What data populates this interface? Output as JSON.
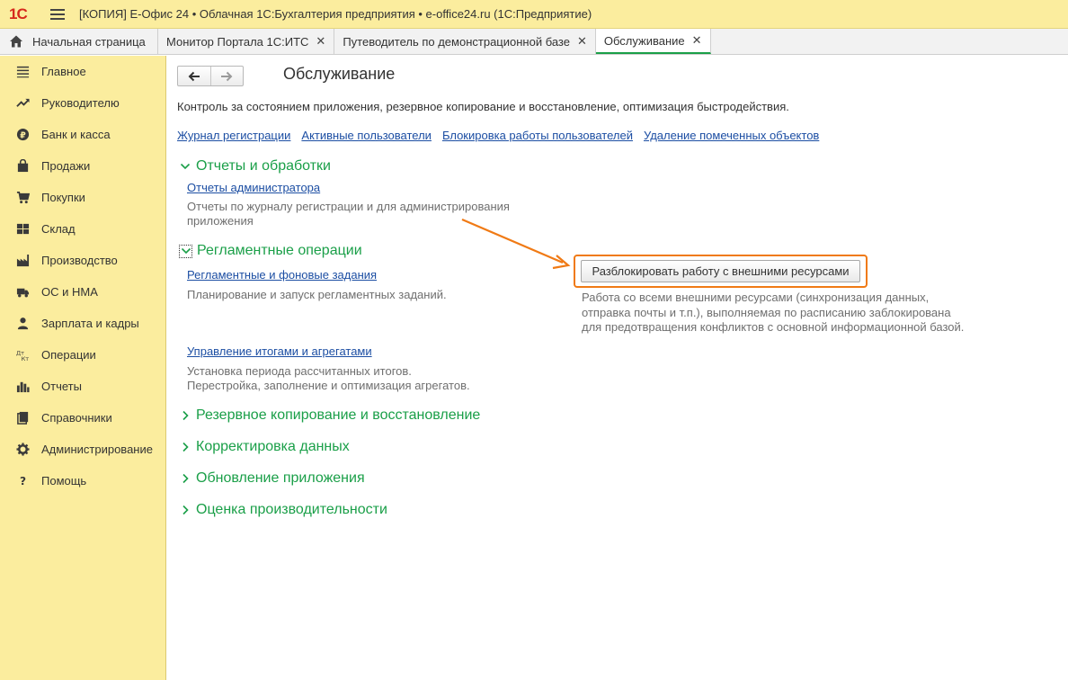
{
  "window": {
    "logo_text": "1С",
    "title": "[КОПИЯ] Е-Офис 24 • Облачная 1С:Бухгалтерия предприятия • e-office24.ru  (1С:Предприятие)"
  },
  "tabs": [
    {
      "label": "Начальная страница"
    },
    {
      "label": "Монитор Портала 1С:ИТС",
      "close": "✕"
    },
    {
      "label": "Путеводитель по демонстрационной базе",
      "close": "✕"
    },
    {
      "label": "Обслуживание",
      "close": "✕",
      "active": true
    }
  ],
  "sidebar": {
    "items": [
      {
        "label": "Главное",
        "icon": "menu-lines-icon"
      },
      {
        "label": "Руководителю",
        "icon": "trend-icon"
      },
      {
        "label": "Банк и касса",
        "icon": "ruble-coin-icon"
      },
      {
        "label": "Продажи",
        "icon": "shopping-bag-icon"
      },
      {
        "label": "Покупки",
        "icon": "cart-icon"
      },
      {
        "label": "Склад",
        "icon": "warehouse-icon"
      },
      {
        "label": "Производство",
        "icon": "factory-icon"
      },
      {
        "label": "ОС и НМА",
        "icon": "truck-icon"
      },
      {
        "label": "Зарплата и кадры",
        "icon": "person-icon"
      },
      {
        "label": "Операции",
        "icon": "dt-kt-icon"
      },
      {
        "label": "Отчеты",
        "icon": "bar-chart-icon"
      },
      {
        "label": "Справочники",
        "icon": "books-icon"
      },
      {
        "label": "Администрирование",
        "icon": "gear-icon"
      },
      {
        "label": "Помощь",
        "icon": "question-icon"
      }
    ]
  },
  "main": {
    "title": "Обслуживание",
    "description": "Контроль за состоянием приложения, резервное копирование и восстановление, оптимизация быстродействия.",
    "links": [
      "Журнал регистрации",
      "Активные пользователи",
      "Блокировка работы пользователей",
      "Удаление помеченных объектов"
    ],
    "sections": {
      "reports": {
        "title": "Отчеты и обработки",
        "link": "Отчеты администратора",
        "desc_line1": "Отчеты по журналу регистрации и для администрирования",
        "desc_line2": "приложения"
      },
      "scheduled": {
        "title": "Регламентные операции",
        "link1": "Регламентные и фоновые задания",
        "desc1": "Планирование и запуск регламентных заданий.",
        "link2": "Управление итогами и агрегатами",
        "desc2_line1": "Установка периода рассчитанных итогов.",
        "desc2_line2": "Перестройка, заполнение и оптимизация агрегатов."
      },
      "backup": {
        "title": "Резервное копирование и восстановление"
      },
      "correction": {
        "title": "Корректировка данных"
      },
      "update": {
        "title": "Обновление приложения"
      },
      "performance": {
        "title": "Оценка производительности"
      }
    },
    "unlock": {
      "button_label": "Разблокировать работу с внешними ресурсами",
      "note_line1": "Работа со всеми внешними ресурсами (синхронизация данных,",
      "note_line2": "отправка почты и т.п.), выполняемая по расписанию заблокирована",
      "note_line3": "для предотвращения конфликтов с основной информационной базой."
    }
  },
  "colors": {
    "titlebar": "#fbed9e",
    "sidebar": "#fbed9e",
    "accent_green": "#1a9f48",
    "link_blue": "#1c4ea3",
    "highlight_orange": "#f07a15"
  }
}
